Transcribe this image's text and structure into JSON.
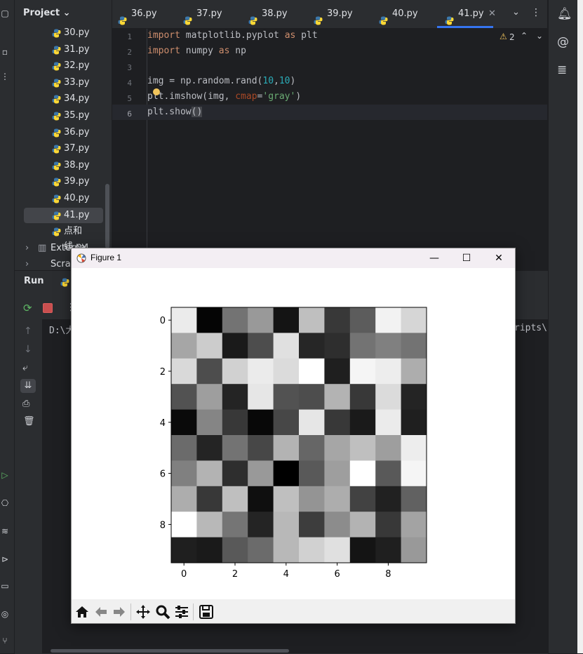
{
  "project": {
    "title": "Project",
    "files": [
      "30.py",
      "31.py",
      "32.py",
      "33.py",
      "34.py",
      "35.py",
      "36.py",
      "37.py",
      "38.py",
      "39.py",
      "40.py",
      "41.py",
      "点和线.py"
    ],
    "selected": "41.py",
    "external": "External Libraries",
    "scratches": "Scratches and Consoles"
  },
  "tabs": [
    "36.py",
    "37.py",
    "38.py",
    "39.py",
    "40.py",
    "41.py"
  ],
  "active_tab": "41.py",
  "editor": {
    "line_numbers": [
      "1",
      "2",
      "3",
      "4",
      "5",
      "6"
    ],
    "inspection_count": "2"
  },
  "run": {
    "title": "Run",
    "console_left": "D:\\大",
    "console_right": "ripts\\"
  },
  "figure": {
    "title": "Figure 1",
    "toolbar": [
      "home-icon",
      "back-icon",
      "forward-icon",
      "pan-icon",
      "zoom-icon",
      "configure-icon",
      "save-icon"
    ]
  },
  "chart_data": {
    "type": "heatmap",
    "colormap": "gray",
    "xticks": [
      "0",
      "2",
      "4",
      "6",
      "8"
    ],
    "yticks": [
      "0",
      "2",
      "4",
      "6",
      "8"
    ],
    "xlim": [
      -0.5,
      9.5
    ],
    "ylim": [
      9.5,
      -0.5
    ],
    "values": [
      [
        0.92,
        0.02,
        0.45,
        0.6,
        0.08,
        0.75,
        0.22,
        0.36,
        0.95,
        0.84
      ],
      [
        0.65,
        0.8,
        0.1,
        0.3,
        0.88,
        0.15,
        0.18,
        0.45,
        0.5,
        0.45
      ],
      [
        0.85,
        0.3,
        0.82,
        0.92,
        0.86,
        1.0,
        0.12,
        0.96,
        0.93,
        0.68
      ],
      [
        0.32,
        0.62,
        0.14,
        0.9,
        0.32,
        0.3,
        0.7,
        0.22,
        0.86,
        0.14
      ],
      [
        0.04,
        0.52,
        0.22,
        0.03,
        0.28,
        0.9,
        0.22,
        0.1,
        0.92,
        0.12
      ],
      [
        0.42,
        0.14,
        0.45,
        0.28,
        0.7,
        0.4,
        0.65,
        0.75,
        0.62,
        0.93
      ],
      [
        0.5,
        0.7,
        0.18,
        0.6,
        0.0,
        0.35,
        0.62,
        1.0,
        0.35,
        0.96
      ],
      [
        0.68,
        0.22,
        0.75,
        0.06,
        0.75,
        0.58,
        0.68,
        0.26,
        0.13,
        0.38
      ],
      [
        1.0,
        0.72,
        0.46,
        0.14,
        0.72,
        0.24,
        0.55,
        0.7,
        0.22,
        0.64
      ],
      [
        0.12,
        0.1,
        0.35,
        0.42,
        0.72,
        0.82,
        0.88,
        0.08,
        0.12,
        0.6
      ]
    ]
  }
}
